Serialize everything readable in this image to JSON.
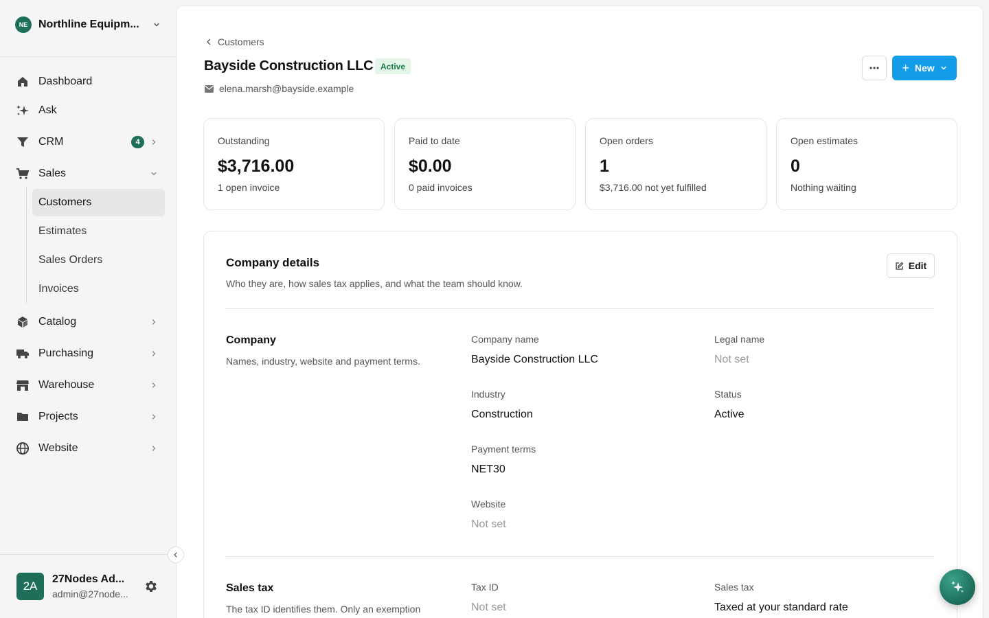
{
  "sidebar": {
    "org": {
      "initials": "NE",
      "name": "Northline Equipm..."
    },
    "nav": [
      {
        "label": "Dashboard",
        "icon": "home-icon"
      },
      {
        "label": "Ask",
        "icon": "sparkles-icon"
      },
      {
        "label": "CRM",
        "icon": "funnel-icon",
        "badge": "4"
      },
      {
        "label": "Sales",
        "icon": "cart-icon"
      },
      {
        "label": "Catalog",
        "icon": "cube-icon"
      },
      {
        "label": "Purchasing",
        "icon": "truck-icon"
      },
      {
        "label": "Warehouse",
        "icon": "store-icon"
      },
      {
        "label": "Projects",
        "icon": "folder-icon"
      },
      {
        "label": "Website",
        "icon": "globe-icon"
      }
    ],
    "sales_sub": [
      "Customers",
      "Estimates",
      "Sales Orders",
      "Invoices"
    ],
    "active_sub": "Customers",
    "user": {
      "initials": "2A",
      "name": "27Nodes Ad...",
      "email": "admin@27node..."
    }
  },
  "header": {
    "breadcrumb": "Customers",
    "title": "Bayside Construction LLC",
    "status": "Active",
    "email": "elena.marsh@bayside.example",
    "new_label": "New"
  },
  "stats": [
    {
      "label": "Outstanding",
      "value": "$3,716.00",
      "sub": "1 open invoice"
    },
    {
      "label": "Paid to date",
      "value": "$0.00",
      "sub": "0 paid invoices"
    },
    {
      "label": "Open orders",
      "value": "1",
      "sub": "$3,716.00 not yet fulfilled"
    },
    {
      "label": "Open estimates",
      "value": "0",
      "sub": "Nothing waiting"
    }
  ],
  "details": {
    "title": "Company details",
    "description": "Who they are, how sales tax applies, and what the team should know.",
    "edit_label": "Edit",
    "company": {
      "title": "Company",
      "description": "Names, industry, website and payment terms.",
      "fields": {
        "company_name": {
          "label": "Company name",
          "value": "Bayside Construction LLC"
        },
        "legal_name": {
          "label": "Legal name",
          "value": "Not set"
        },
        "industry": {
          "label": "Industry",
          "value": "Construction"
        },
        "status": {
          "label": "Status",
          "value": "Active"
        },
        "payment_terms": {
          "label": "Payment terms",
          "value": "NET30"
        },
        "website": {
          "label": "Website",
          "value": "Not set"
        }
      }
    },
    "sales_tax": {
      "title": "Sales tax",
      "description": "The tax ID identifies them. Only an exemption",
      "fields": {
        "tax_id": {
          "label": "Tax ID",
          "value": "Not set"
        },
        "sales_tax": {
          "label": "Sales tax",
          "value": "Taxed at your standard rate"
        }
      }
    }
  },
  "colors": {
    "accent": "#139ce8",
    "brand": "#1f6e5a",
    "active_pill_bg": "#e4f5ea",
    "active_pill_text": "#1a7a45"
  }
}
